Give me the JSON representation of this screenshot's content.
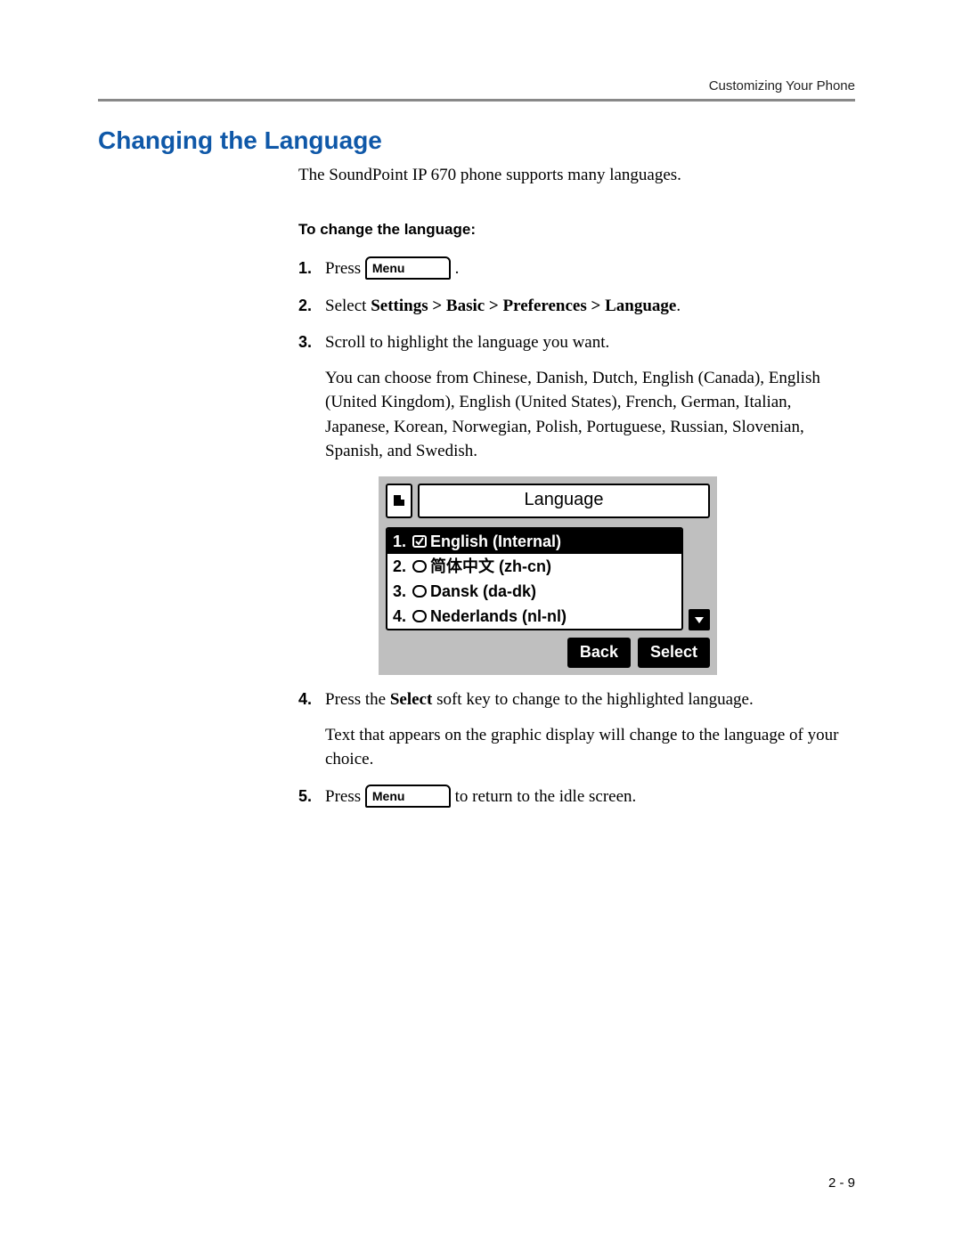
{
  "header": {
    "running": "Customizing Your Phone"
  },
  "title": "Changing the Language",
  "intro": "The SoundPoint IP 670 phone supports many languages.",
  "subhead": "To change the language:",
  "menu_key_label": "Menu",
  "steps": {
    "s1_a": "Press ",
    "s1_c": " .",
    "s2_a": "Select ",
    "s2_b": "Settings > Basic > Preferences > Language",
    "s2_c": ".",
    "s3_a": "Scroll to highlight the language you want.",
    "s3_p": "You can choose from Chinese, Danish, Dutch, English (Canada), English (United Kingdom), English (United States), French, German, Italian, Japanese, Korean, Norwegian, Polish, Portuguese, Russian, Slovenian, Spanish, and Swedish.",
    "s4_a": "Press the ",
    "s4_b": "Select",
    "s4_c": " soft key to change to the highlighted language.",
    "s4_p": "Text that appears on the graphic display will change to the language of your choice.",
    "s5_a": "Press ",
    "s5_c": " to return to the idle screen."
  },
  "phone": {
    "title": "Language",
    "items": [
      {
        "num": "1.",
        "label": "English (Internal)",
        "checked": true,
        "selected": true
      },
      {
        "num": "2.",
        "label": "简体中文 (zh-cn)",
        "checked": false,
        "selected": false
      },
      {
        "num": "3.",
        "label": "Dansk (da-dk)",
        "checked": false,
        "selected": false
      },
      {
        "num": "4.",
        "label": "Nederlands (nl-nl)",
        "checked": false,
        "selected": false
      }
    ],
    "softkeys": {
      "back": "Back",
      "select": "Select"
    }
  },
  "footer": "2 - 9"
}
